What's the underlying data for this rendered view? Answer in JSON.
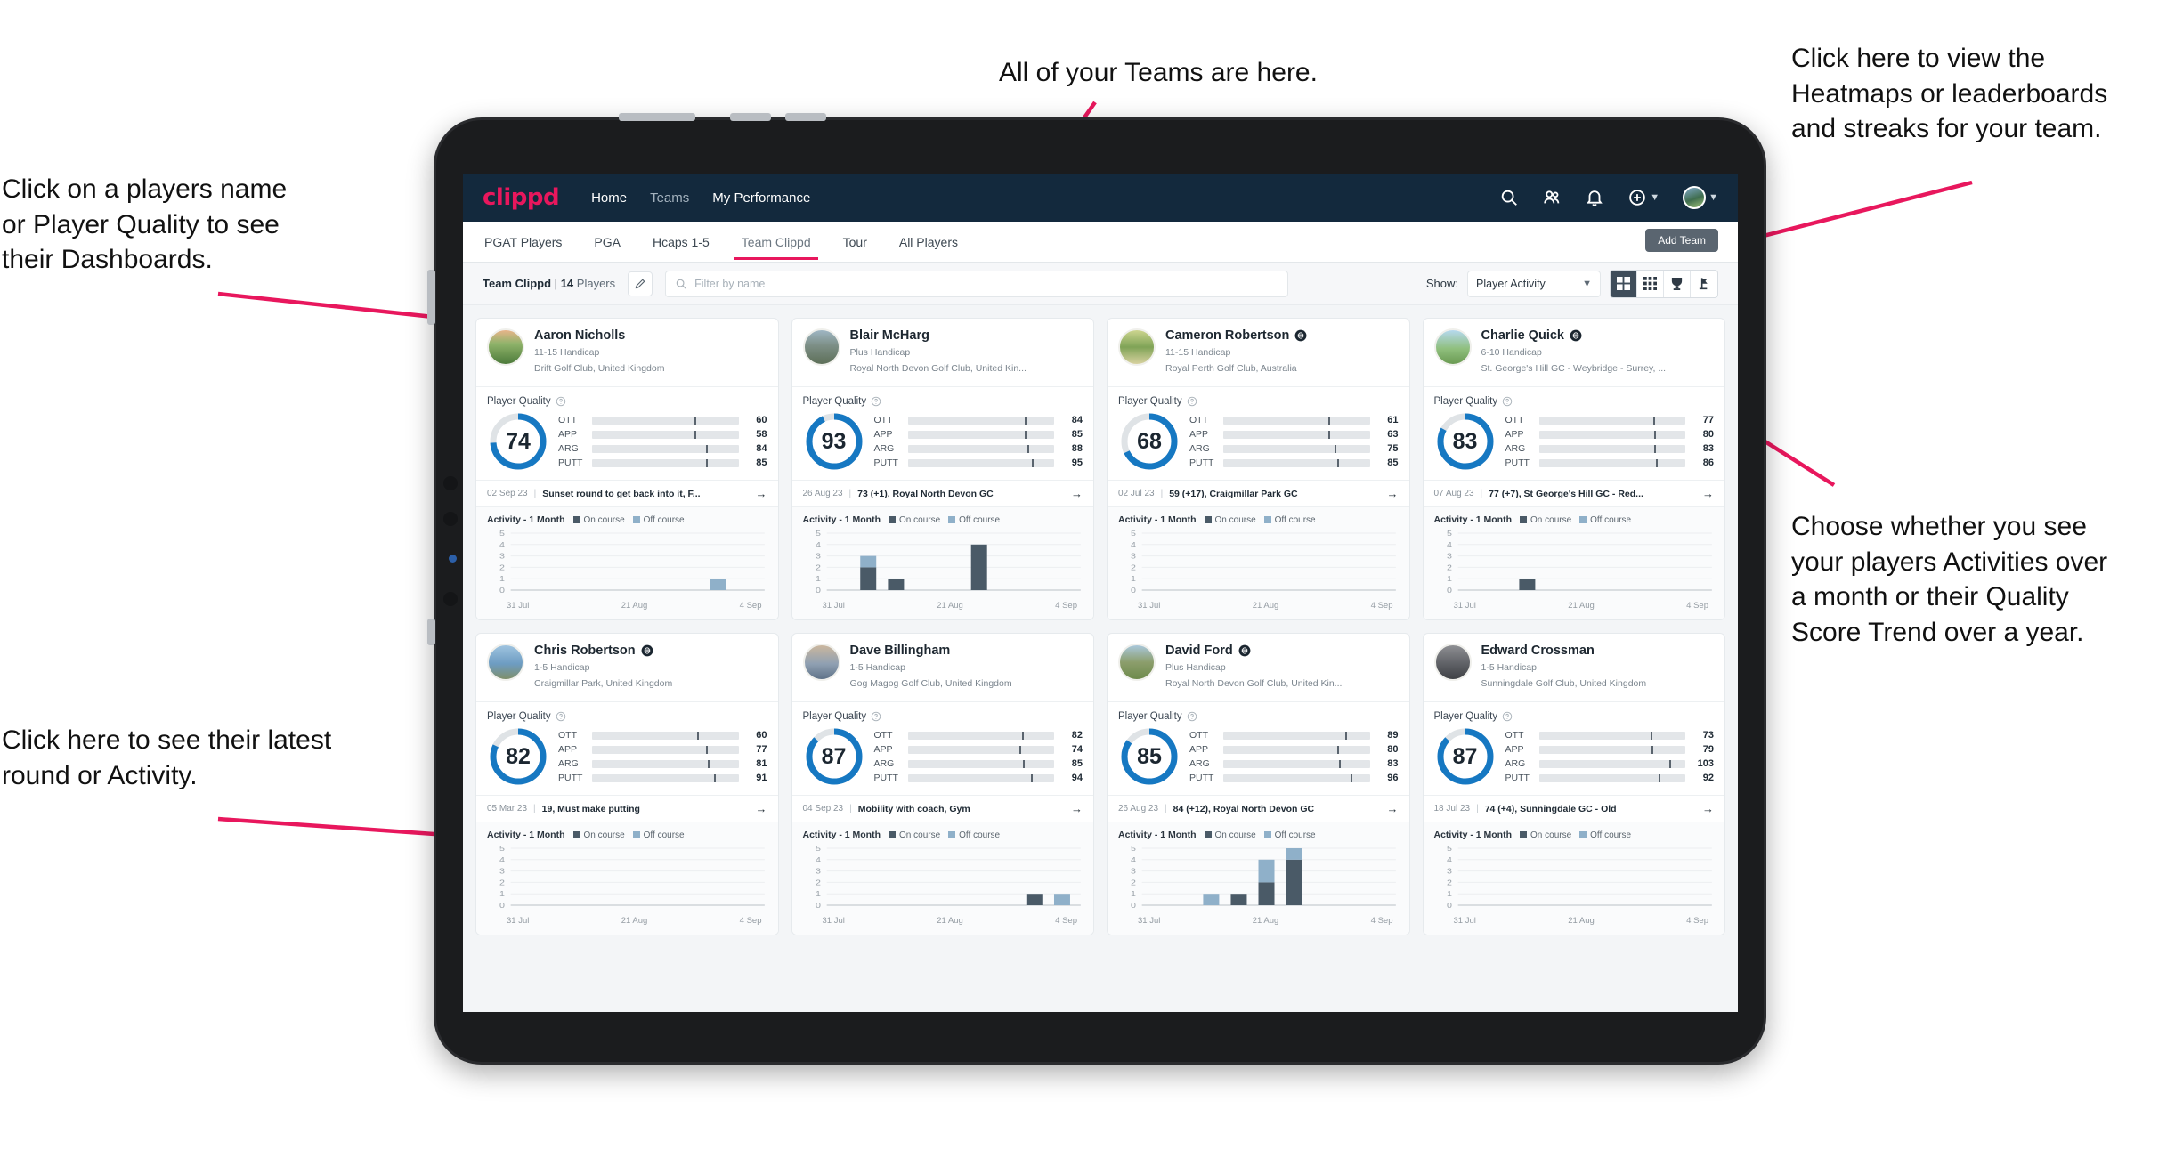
{
  "annotations": {
    "players": "Click on a players name\nor Player Quality to see\ntheir Dashboards.",
    "teams": "All of your Teams are here.",
    "heatmaps": "Click here to view the\nHeatmaps or leaderboards\nand streaks for your team.",
    "choose": "Choose whether you see\nyour players Activities over\na month or their Quality\nScore Trend over a year.",
    "latest": "Click here to see their latest\nround or Activity."
  },
  "header": {
    "logo": "clippd",
    "nav": [
      {
        "label": "Home",
        "active": true
      },
      {
        "label": "Teams",
        "active": false
      },
      {
        "label": "My Performance",
        "active": true
      }
    ],
    "icons": [
      "search-icon",
      "people-icon",
      "bell-icon",
      "plus-circle-icon",
      "avatar"
    ]
  },
  "tabs": {
    "items": [
      {
        "label": "PGAT Players",
        "active": false
      },
      {
        "label": "PGA",
        "active": false
      },
      {
        "label": "Hcaps 1-5",
        "active": false
      },
      {
        "label": "Team Clippd",
        "active": true
      },
      {
        "label": "Tour",
        "active": false
      },
      {
        "label": "All Players",
        "active": false
      }
    ],
    "add_team_label": "Add Team"
  },
  "filterbar": {
    "team_name": "Team Clippd",
    "divider": "|",
    "player_count": "14",
    "players_word": "Players",
    "search_placeholder": "Filter by name",
    "show_label": "Show:",
    "show_value": "Player Activity",
    "view_modes": [
      "grid-large-icon",
      "grid-small-icon",
      "trophy-icon",
      "golf-flag-icon"
    ],
    "active_view": 0
  },
  "colors": {
    "brand": "#e8175d",
    "header_bg": "#13293d",
    "ring": "#1678c2",
    "ott": "#f5a623",
    "app": "#3ad6b0",
    "arg": "#f0236a",
    "putt": "#a812c4",
    "on_course": "#4a5a67",
    "off_course": "#8fb0c9"
  },
  "card_labels": {
    "player_quality": "Player Quality",
    "activity_title": "Activity - 1 Month",
    "on_course": "On course",
    "off_course": "Off course",
    "metrics": [
      "OTT",
      "APP",
      "ARG",
      "PUTT"
    ],
    "x_ticks": [
      "31 Jul",
      "21 Aug",
      "4 Sep"
    ],
    "y_ticks": [
      "5",
      "4",
      "3",
      "2",
      "1",
      "0"
    ]
  },
  "chart_data": {
    "type": "bar",
    "title": "Activity - 1 Month",
    "xlabel": "",
    "ylabel": "",
    "ylim": [
      0,
      5
    ],
    "categories": [
      "31 Jul",
      "21 Aug",
      "4 Sep"
    ],
    "legend": [
      "On course",
      "Off course"
    ],
    "legend_position": "top",
    "grid": true,
    "per_player_bars": {
      "Aaron Nicholls": [
        {
          "slot": 7,
          "on": 0,
          "off": 1
        }
      ],
      "Blair McHarg": [
        {
          "slot": 1,
          "on": 2,
          "off": 1
        },
        {
          "slot": 2,
          "on": 1,
          "off": 0
        },
        {
          "slot": 5,
          "on": 4,
          "off": 0
        }
      ],
      "Cameron Robertson": [],
      "Charlie Quick": [
        {
          "slot": 2,
          "on": 1,
          "off": 0
        }
      ],
      "Chris Robertson": [],
      "Dave Billingham": [
        {
          "slot": 7,
          "on": 1,
          "off": 0
        },
        {
          "slot": 8,
          "on": 0,
          "off": 1
        }
      ],
      "David Ford": [
        {
          "slot": 2,
          "on": 0,
          "off": 1
        },
        {
          "slot": 3,
          "on": 1,
          "off": 0
        },
        {
          "slot": 4,
          "on": 2,
          "off": 2
        },
        {
          "slot": 5,
          "on": 4,
          "off": 1
        }
      ],
      "Edward Crossman": []
    }
  },
  "players": [
    {
      "name": "Aaron Nicholls",
      "verified": false,
      "handicap": "11-15 Handicap",
      "club": "Drift Golf Club, United Kingdom",
      "quality": 74,
      "metrics": [
        {
          "key": "OTT",
          "value": 60,
          "fill": 55,
          "tick": 70
        },
        {
          "key": "APP",
          "value": 58,
          "fill": 53,
          "tick": 70
        },
        {
          "key": "ARG",
          "value": 84,
          "fill": 72,
          "tick": 78
        },
        {
          "key": "PUTT",
          "value": 85,
          "fill": 72,
          "tick": 78
        }
      ],
      "round_date": "02 Sep 23",
      "round_text": "Sunset round to get back into it, F...",
      "avatar_style": "course-sunset"
    },
    {
      "name": "Blair McHarg",
      "verified": false,
      "handicap": "Plus Handicap",
      "club": "Royal North Devon Golf Club, United Kin...",
      "quality": 93,
      "metrics": [
        {
          "key": "OTT",
          "value": 84,
          "fill": 74,
          "tick": 80
        },
        {
          "key": "APP",
          "value": 85,
          "fill": 74,
          "tick": 80
        },
        {
          "key": "ARG",
          "value": 88,
          "fill": 78,
          "tick": 82
        },
        {
          "key": "PUTT",
          "value": 95,
          "fill": 82,
          "tick": 85
        }
      ],
      "round_date": "26 Aug 23",
      "round_text": "73 (+1), Royal North Devon GC",
      "avatar_style": "course-links"
    },
    {
      "name": "Cameron Robertson",
      "verified": true,
      "handicap": "11-15 Handicap",
      "club": "Royal Perth Golf Club, Australia",
      "quality": 68,
      "metrics": [
        {
          "key": "OTT",
          "value": 61,
          "fill": 55,
          "tick": 72
        },
        {
          "key": "APP",
          "value": 63,
          "fill": 55,
          "tick": 72
        },
        {
          "key": "ARG",
          "value": 75,
          "fill": 66,
          "tick": 76
        },
        {
          "key": "PUTT",
          "value": 85,
          "fill": 72,
          "tick": 78
        }
      ],
      "round_date": "02 Jul 23",
      "round_text": "59 (+17), Craigmillar Park GC",
      "avatar_style": "course-tree"
    },
    {
      "name": "Charlie Quick",
      "verified": true,
      "handicap": "6-10 Handicap",
      "club": "St. George's Hill GC - Weybridge - Surrey, ...",
      "quality": 83,
      "metrics": [
        {
          "key": "OTT",
          "value": 77,
          "fill": 66,
          "tick": 78
        },
        {
          "key": "APP",
          "value": 80,
          "fill": 70,
          "tick": 79
        },
        {
          "key": "ARG",
          "value": 83,
          "fill": 70,
          "tick": 79
        },
        {
          "key": "PUTT",
          "value": 86,
          "fill": 74,
          "tick": 80
        }
      ],
      "round_date": "07 Aug 23",
      "round_text": "77 (+7), St George's Hill GC - Red...",
      "avatar_style": "course-sky"
    },
    {
      "name": "Chris Robertson",
      "verified": true,
      "handicap": "1-5 Handicap",
      "club": "Craigmillar Park, United Kingdom",
      "quality": 82,
      "metrics": [
        {
          "key": "OTT",
          "value": 60,
          "fill": 55,
          "tick": 72
        },
        {
          "key": "APP",
          "value": 77,
          "fill": 67,
          "tick": 78
        },
        {
          "key": "ARG",
          "value": 81,
          "fill": 70,
          "tick": 79
        },
        {
          "key": "PUTT",
          "value": 91,
          "fill": 78,
          "tick": 83
        }
      ],
      "round_date": "05 Mar 23",
      "round_text": "19, Must make putting",
      "avatar_style": "person-a"
    },
    {
      "name": "Dave Billingham",
      "verified": false,
      "handicap": "1-5 Handicap",
      "club": "Gog Magog Golf Club, United Kingdom",
      "quality": 87,
      "metrics": [
        {
          "key": "OTT",
          "value": 82,
          "fill": 70,
          "tick": 78
        },
        {
          "key": "APP",
          "value": 74,
          "fill": 64,
          "tick": 76
        },
        {
          "key": "ARG",
          "value": 85,
          "fill": 72,
          "tick": 79
        },
        {
          "key": "PUTT",
          "value": 94,
          "fill": 80,
          "tick": 84
        }
      ],
      "round_date": "04 Sep 23",
      "round_text": "Mobility with coach, Gym",
      "avatar_style": "person-b"
    },
    {
      "name": "David Ford",
      "verified": true,
      "handicap": "Plus Handicap",
      "club": "Royal North Devon Golf Club, United Kin...",
      "quality": 85,
      "metrics": [
        {
          "key": "OTT",
          "value": 89,
          "fill": 78,
          "tick": 83
        },
        {
          "key": "APP",
          "value": 80,
          "fill": 69,
          "tick": 78
        },
        {
          "key": "ARG",
          "value": 83,
          "fill": 71,
          "tick": 79
        },
        {
          "key": "PUTT",
          "value": 96,
          "fill": 84,
          "tick": 87
        }
      ],
      "round_date": "26 Aug 23",
      "round_text": "84 (+12), Royal North Devon GC",
      "avatar_style": "course-walk"
    },
    {
      "name": "Edward Crossman",
      "verified": false,
      "handicap": "1-5 Handicap",
      "club": "Sunningdale Golf Club, United Kingdom",
      "quality": 87,
      "metrics": [
        {
          "key": "OTT",
          "value": 73,
          "fill": 63,
          "tick": 76
        },
        {
          "key": "APP",
          "value": 79,
          "fill": 67,
          "tick": 77
        },
        {
          "key": "ARG",
          "value": 103,
          "fill": 84,
          "tick": 89
        },
        {
          "key": "PUTT",
          "value": 92,
          "fill": 77,
          "tick": 82
        }
      ],
      "round_date": "18 Jul 23",
      "round_text": "74 (+4), Sunningdale GC - Old",
      "avatar_style": "person-c"
    }
  ]
}
